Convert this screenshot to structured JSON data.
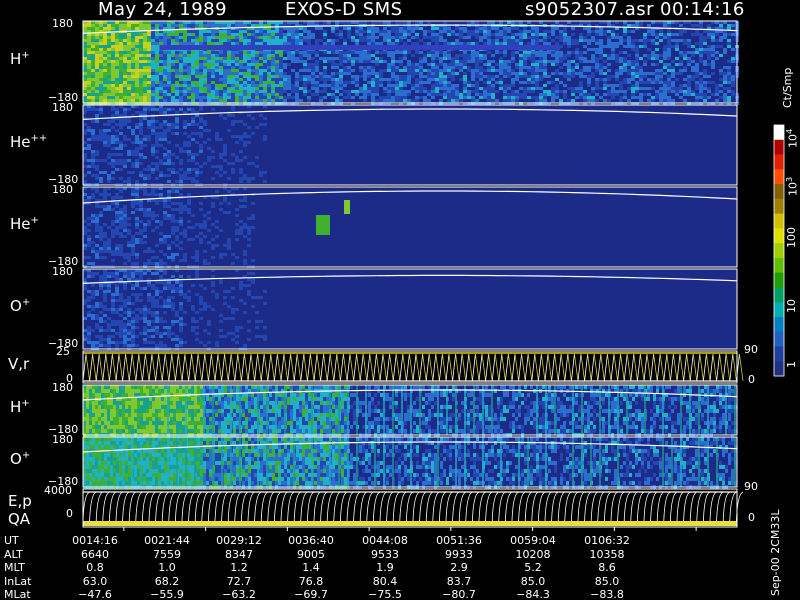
{
  "header": {
    "date": "May 24, 1989",
    "instrument": "EXOS-D SMS",
    "file": "s9052307.asr",
    "time": "00:14:16"
  },
  "colorbar": {
    "unit": "Ct/Smp",
    "ticks": [
      "10",
      "10",
      "100",
      "10",
      "1"
    ],
    "tick_exp": [
      "4",
      "3",
      "",
      "",
      ""
    ],
    "colors": [
      "#ffffff",
      "#b00000",
      "#e02000",
      "#ff5000",
      "#806000",
      "#a08000",
      "#d0c000",
      "#e0e000",
      "#a0d000",
      "#60c000",
      "#20a000",
      "#00a060",
      "#00b0b0",
      "#0080c0",
      "#2060c0",
      "#2040a0",
      "#203080"
    ]
  },
  "panels": [
    {
      "id": "hplus",
      "species": "H",
      "charge": "+",
      "ymax": "180",
      "ymin": "−180"
    },
    {
      "id": "heplusplus",
      "species": "He",
      "charge": "++",
      "ymax": "180",
      "ymin": "−180"
    },
    {
      "id": "heplus",
      "species": "He",
      "charge": "+",
      "ymax": "180",
      "ymin": "−180"
    },
    {
      "id": "oplus",
      "species": "O",
      "charge": "+",
      "ymax": "180",
      "ymin": "−180"
    }
  ],
  "vr_panel": {
    "label": "V,r",
    "left_tick": "25",
    "left_zero": "0",
    "right_top": "90",
    "right_bottom": "0"
  },
  "lower_panels": [
    {
      "id": "hplus2",
      "species": "H",
      "charge": "+",
      "ymax": "180",
      "ymin": "−180"
    },
    {
      "id": "oplus2",
      "species": "O",
      "charge": "+",
      "ymax": "180",
      "ymin": "−180"
    }
  ],
  "ep_panel": {
    "label1": "E,p",
    "label2": "QA",
    "left_tick": "4000",
    "left_zero": "0",
    "right_top": "90",
    "right_bottom": "0"
  },
  "footer_side": "Sep-00  2CM33L",
  "ephemeris": {
    "rows": [
      {
        "label": "UT",
        "values": [
          "0014:16",
          "0021:44",
          "0029:12",
          "0036:40",
          "0044:08",
          "0051:36",
          "0059:04",
          "0106:32"
        ]
      },
      {
        "label": "ALT",
        "values": [
          "6640",
          "7559",
          "8347",
          "9005",
          "9533",
          "9933",
          "10208",
          "10358"
        ]
      },
      {
        "label": "MLT",
        "values": [
          "0.8",
          "1.0",
          "1.2",
          "1.4",
          "1.9",
          "2.9",
          "5.2",
          "8.6"
        ]
      },
      {
        "label": "InLat",
        "values": [
          "63.0",
          "68.2",
          "72.7",
          "76.8",
          "80.4",
          "83.7",
          "85.0",
          "85.0"
        ]
      },
      {
        "label": "MLat",
        "values": [
          "−47.6",
          "−55.9",
          "−63.2",
          "−69.7",
          "−75.5",
          "−80.7",
          "−84.3",
          "−83.8"
        ]
      }
    ]
  },
  "chart_data": {
    "type": "heatmap",
    "title": "May 24, 1989   EXOS-D SMS",
    "ylim": [
      -180,
      180
    ],
    "x": [
      "0014:16",
      "0021:44",
      "0029:12",
      "0036:40",
      "0044:08",
      "0051:36",
      "0059:04",
      "0106:32"
    ],
    "series": [
      {
        "name": "H+"
      },
      {
        "name": "He++"
      },
      {
        "name": "He+"
      },
      {
        "name": "O+"
      },
      {
        "name": "V,r"
      },
      {
        "name": "H+"
      },
      {
        "name": "O+"
      },
      {
        "name": "E,p"
      }
    ],
    "colorbar_unit": "Ct/Smp",
    "colorbar_range": [
      1,
      10000
    ],
    "colorbar_scale": "log"
  }
}
